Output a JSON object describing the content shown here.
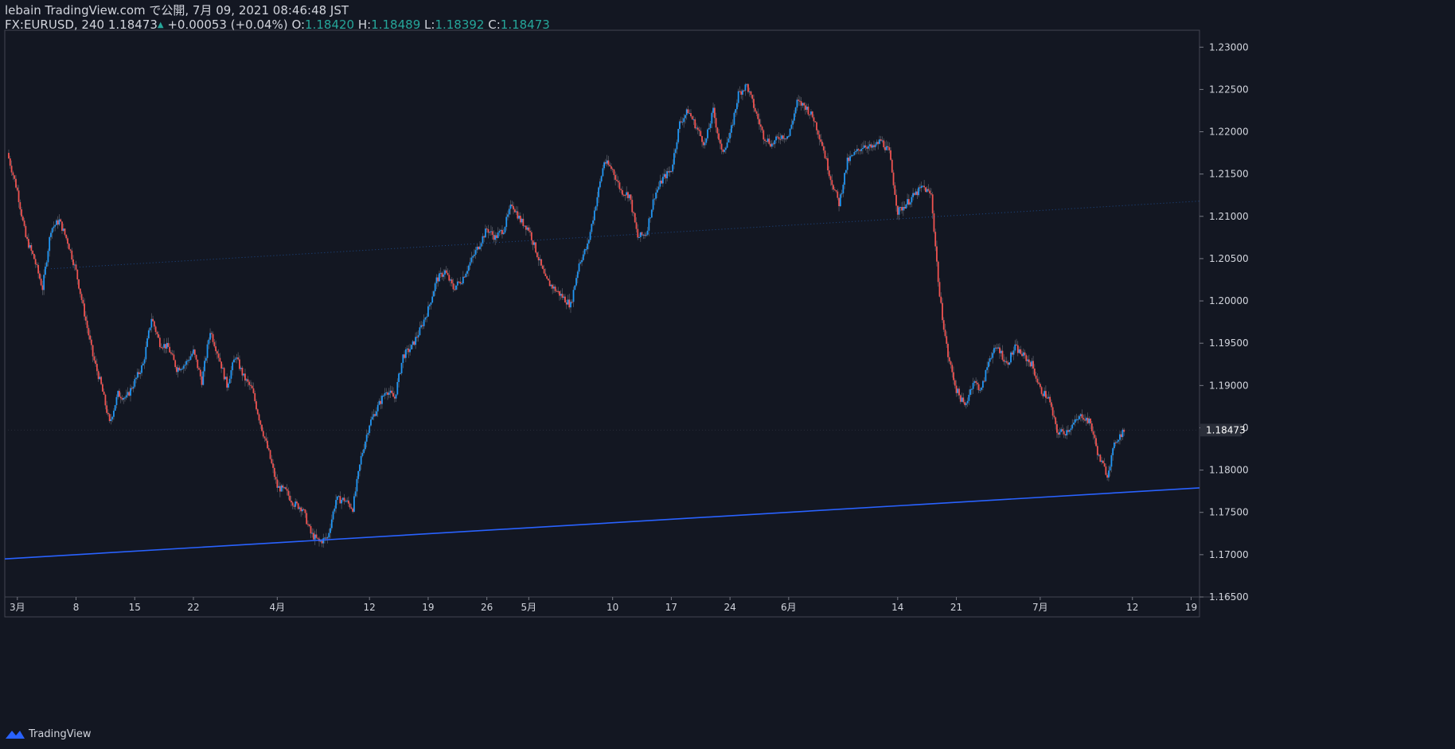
{
  "header": {
    "publish_line": "lebain TradingView.com で公開, 7月 09, 2021 08:46:48 JST",
    "symbol": "FX:EURUSD, 240",
    "last": "1.18473",
    "change": "+0.00053 (+0.04%)",
    "o_label": "O:",
    "o_value": "1.18420",
    "h_label": "H:",
    "h_value": "1.18489",
    "l_label": "L:",
    "l_value": "1.18392",
    "c_label": "C:",
    "c_value": "1.18473"
  },
  "footer": {
    "brand": "TradingView"
  },
  "colors": {
    "background": "#131722",
    "up": "#2962ff",
    "up_light": "#2196f3",
    "down": "#ef5350",
    "trendline": "#2962ff",
    "axis_text": "#d1d4dc",
    "green_value": "#26a69a"
  },
  "chart_data": {
    "type": "candlestick",
    "ylim": [
      1.165,
      1.232
    ],
    "y_ticks": [
      "1.23000",
      "1.22500",
      "1.22000",
      "1.21500",
      "1.21000",
      "1.20500",
      "1.20000",
      "1.19500",
      "1.19000",
      "1.18500",
      "1.18000",
      "1.17500",
      "1.17000",
      "1.16500"
    ],
    "x_ticks": [
      "3月",
      "8",
      "15",
      "22",
      "4月",
      "12",
      "19",
      "26",
      "5月",
      "10",
      "17",
      "24",
      "6月",
      "14",
      "21",
      "7月",
      "12",
      "19"
    ],
    "x_tick_days": [
      0,
      7,
      14,
      21,
      31,
      42,
      49,
      56,
      61,
      71,
      78,
      85,
      92,
      105,
      112,
      122,
      133,
      140
    ],
    "x_range_days": [
      -1.5,
      141
    ],
    "last_price": "1.18473",
    "close_path": [
      [
        -1.2,
        1.2175
      ],
      [
        0,
        1.213
      ],
      [
        1,
        1.2075
      ],
      [
        2,
        1.205
      ],
      [
        3,
        1.2015
      ],
      [
        4,
        1.2085
      ],
      [
        5,
        1.2095
      ],
      [
        6,
        1.207
      ],
      [
        7,
        1.2035
      ],
      [
        8,
        1.1985
      ],
      [
        9,
        1.1935
      ],
      [
        10,
        1.19
      ],
      [
        11,
        1.1855
      ],
      [
        12,
        1.189
      ],
      [
        13,
        1.1885
      ],
      [
        14,
        1.1905
      ],
      [
        15,
        1.1925
      ],
      [
        16,
        1.198
      ],
      [
        17,
        1.195
      ],
      [
        18,
        1.1945
      ],
      [
        19,
        1.192
      ],
      [
        20,
        1.1925
      ],
      [
        21,
        1.194
      ],
      [
        22,
        1.1905
      ],
      [
        23,
        1.1965
      ],
      [
        24,
        1.1935
      ],
      [
        25,
        1.19
      ],
      [
        26,
        1.1935
      ],
      [
        27,
        1.191
      ],
      [
        28,
        1.1895
      ],
      [
        29,
        1.1855
      ],
      [
        30,
        1.182
      ],
      [
        31,
        1.178
      ],
      [
        32,
        1.1775
      ],
      [
        33,
        1.176
      ],
      [
        34,
        1.1755
      ],
      [
        35,
        1.1725
      ],
      [
        36,
        1.1715
      ],
      [
        37,
        1.172
      ],
      [
        38,
        1.1765
      ],
      [
        39,
        1.1765
      ],
      [
        40,
        1.1755
      ],
      [
        41,
        1.1815
      ],
      [
        42,
        1.1855
      ],
      [
        43,
        1.1875
      ],
      [
        44,
        1.1895
      ],
      [
        45,
        1.1885
      ],
      [
        46,
        1.1935
      ],
      [
        47,
        1.1945
      ],
      [
        48,
        1.1965
      ],
      [
        49,
        1.199
      ],
      [
        50,
        1.2025
      ],
      [
        51,
        1.2035
      ],
      [
        52,
        1.2015
      ],
      [
        53,
        1.2025
      ],
      [
        54,
        1.2045
      ],
      [
        55,
        1.2065
      ],
      [
        56,
        1.2085
      ],
      [
        57,
        1.2075
      ],
      [
        58,
        1.2085
      ],
      [
        59,
        1.2115
      ],
      [
        60,
        1.2095
      ],
      [
        61,
        1.2085
      ],
      [
        62,
        1.2055
      ],
      [
        63,
        1.2025
      ],
      [
        64,
        1.2015
      ],
      [
        65,
        1.2005
      ],
      [
        66,
        1.1995
      ],
      [
        67,
        1.2045
      ],
      [
        68,
        1.2065
      ],
      [
        69,
        1.2115
      ],
      [
        70,
        1.2165
      ],
      [
        71,
        1.2155
      ],
      [
        72,
        1.213
      ],
      [
        73,
        1.2125
      ],
      [
        74,
        1.2075
      ],
      [
        75,
        1.208
      ],
      [
        76,
        1.2125
      ],
      [
        77,
        1.2145
      ],
      [
        78,
        1.2155
      ],
      [
        79,
        1.221
      ],
      [
        80,
        1.2225
      ],
      [
        81,
        1.2205
      ],
      [
        82,
        1.2185
      ],
      [
        83,
        1.2225
      ],
      [
        84,
        1.2175
      ],
      [
        85,
        1.2195
      ],
      [
        86,
        1.2245
      ],
      [
        87,
        1.2255
      ],
      [
        88,
        1.2225
      ],
      [
        89,
        1.2195
      ],
      [
        90,
        1.2185
      ],
      [
        91,
        1.2195
      ],
      [
        92,
        1.2195
      ],
      [
        93,
        1.2235
      ],
      [
        94,
        1.223
      ],
      [
        95,
        1.2215
      ],
      [
        96,
        1.2185
      ],
      [
        97,
        1.2145
      ],
      [
        98,
        1.2115
      ],
      [
        99,
        1.2165
      ],
      [
        100,
        1.2175
      ],
      [
        101,
        1.2185
      ],
      [
        102,
        1.218
      ],
      [
        103,
        1.219
      ],
      [
        104,
        1.2175
      ],
      [
        105,
        1.2105
      ],
      [
        106,
        1.2115
      ],
      [
        107,
        1.2125
      ],
      [
        108,
        1.2135
      ],
      [
        109,
        1.2125
      ],
      [
        110,
        1.2005
      ],
      [
        111,
        1.1935
      ],
      [
        112,
        1.1895
      ],
      [
        113,
        1.1875
      ],
      [
        114,
        1.1905
      ],
      [
        115,
        1.1895
      ],
      [
        116,
        1.1935
      ],
      [
        117,
        1.1945
      ],
      [
        118,
        1.1925
      ],
      [
        119,
        1.1945
      ],
      [
        120,
        1.1935
      ],
      [
        121,
        1.1925
      ],
      [
        122,
        1.1895
      ],
      [
        123,
        1.1885
      ],
      [
        124,
        1.1845
      ],
      [
        125,
        1.1845
      ],
      [
        126,
        1.1855
      ],
      [
        127,
        1.1865
      ],
      [
        128,
        1.1855
      ],
      [
        129,
        1.1815
      ],
      [
        130,
        1.1795
      ],
      [
        131,
        1.1835
      ],
      [
        132,
        1.1847
      ]
    ],
    "trendlines": [
      {
        "style": "solid",
        "from": [
          -1.5,
          1.1695
        ],
        "to": [
          141,
          1.1779
        ]
      },
      {
        "style": "dotted",
        "from": [
          4,
          1.2038
        ],
        "to": [
          141,
          1.2118
        ]
      }
    ]
  }
}
